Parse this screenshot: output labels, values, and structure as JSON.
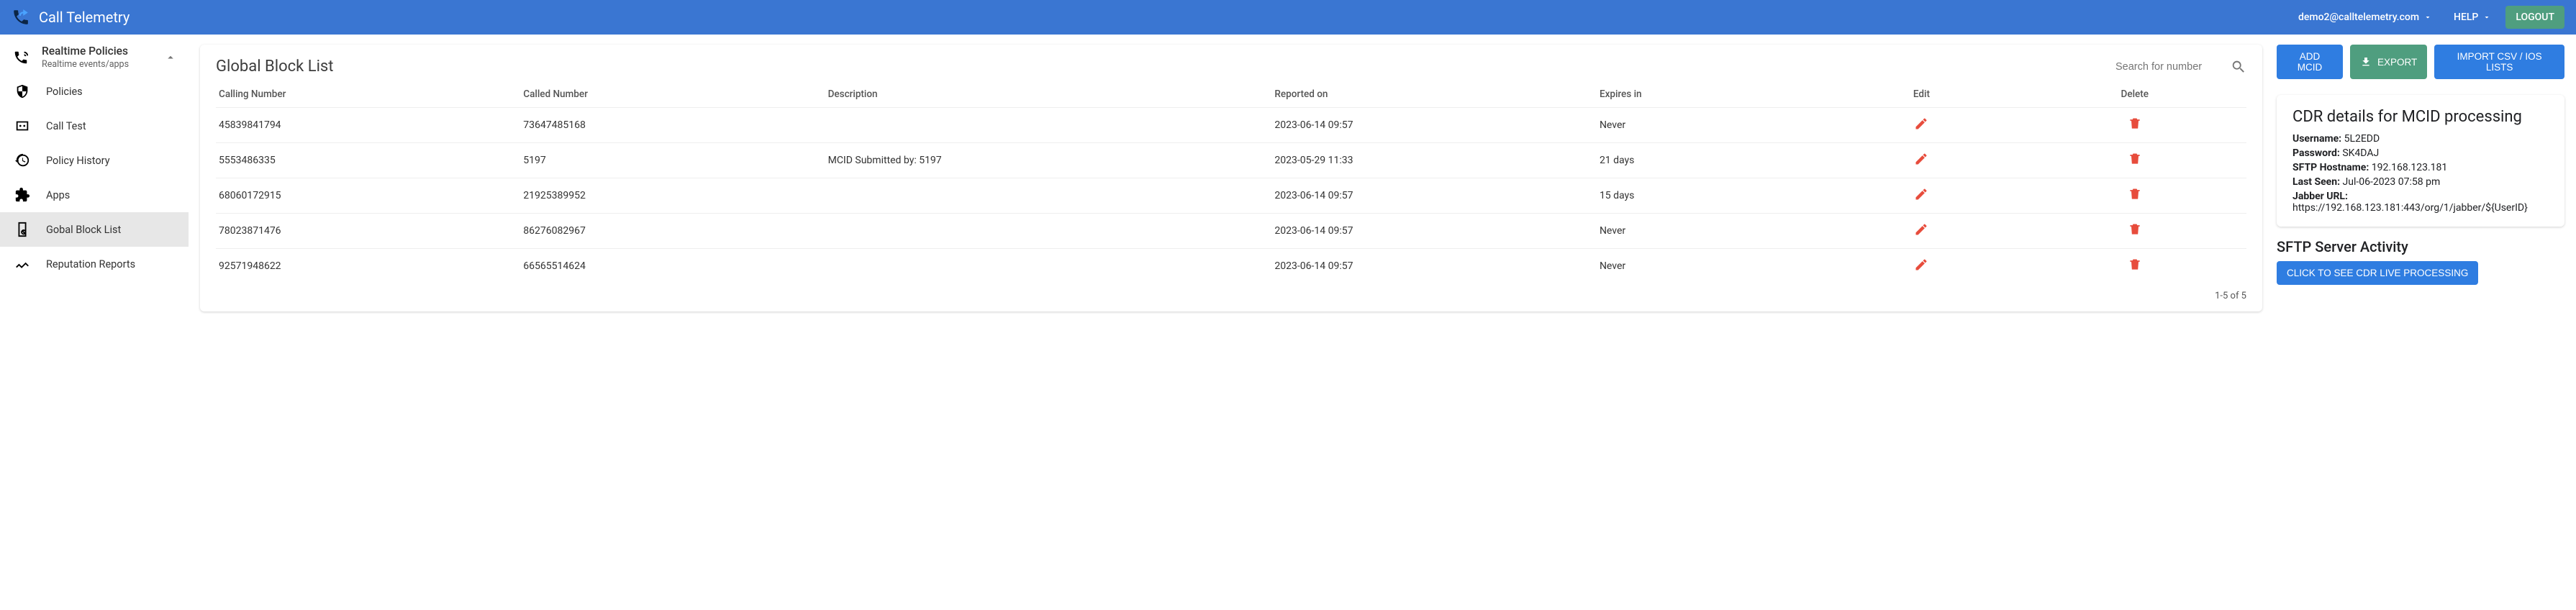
{
  "header": {
    "app_title": "Call Telemetry",
    "user_email": "demo2@calltelemetry.com",
    "help_label": "HELP",
    "logout_label": "LOGOUT"
  },
  "sidebar": {
    "section_title": "Realtime Policies",
    "section_sub": "Realtime events/apps",
    "items": [
      {
        "label": "Policies",
        "icon": "policies"
      },
      {
        "label": "Call Test",
        "icon": "calltest"
      },
      {
        "label": "Policy History",
        "icon": "history"
      },
      {
        "label": "Apps",
        "icon": "apps"
      },
      {
        "label": "Gobal Block List",
        "icon": "block",
        "active": true
      },
      {
        "label": "Reputation Reports",
        "icon": "report"
      }
    ]
  },
  "actions": {
    "add_mcid": "ADD MCID",
    "export": "EXPORT",
    "import": "IMPORT CSV / IOS LISTS"
  },
  "table": {
    "title": "Global Block List",
    "search_placeholder": "Search for number",
    "columns": {
      "calling": "Calling Number",
      "called": "Called Number",
      "desc": "Description",
      "reported": "Reported on",
      "expires": "Expires in",
      "edit": "Edit",
      "delete": "Delete"
    },
    "rows": [
      {
        "calling": "45839841794",
        "called": "73647485168",
        "desc": "",
        "reported": "2023-06-14 09:57",
        "expires": "Never"
      },
      {
        "calling": "5553486335",
        "called": "5197",
        "desc": "MCID Submitted by: 5197",
        "reported": "2023-05-29 11:33",
        "expires": "21 days"
      },
      {
        "calling": "68060172915",
        "called": "21925389952",
        "desc": "",
        "reported": "2023-06-14 09:57",
        "expires": "15 days"
      },
      {
        "calling": "78023871476",
        "called": "86276082967",
        "desc": "",
        "reported": "2023-06-14 09:57",
        "expires": "Never"
      },
      {
        "calling": "92571948622",
        "called": "66565514624",
        "desc": "",
        "reported": "2023-06-14 09:57",
        "expires": "Never"
      }
    ],
    "pagination": "1-5 of 5"
  },
  "cdr": {
    "title": "CDR details for MCID processing",
    "username_label": "Username:",
    "username": "5L2EDD",
    "password_label": "Password:",
    "password": "SK4DAJ",
    "host_label": "SFTP Hostname:",
    "host": "192.168.123.181",
    "lastseen_label": "Last Seen:",
    "lastseen": "Jul-06-2023 07:58 pm",
    "jabber_label": "Jabber URL:",
    "jabber": "https://192.168.123.181:443/org/1/jabber/${UserID}"
  },
  "sftp": {
    "title": "SFTP Server Activity",
    "button": "CLICK TO SEE CDR LIVE PROCESSING"
  }
}
